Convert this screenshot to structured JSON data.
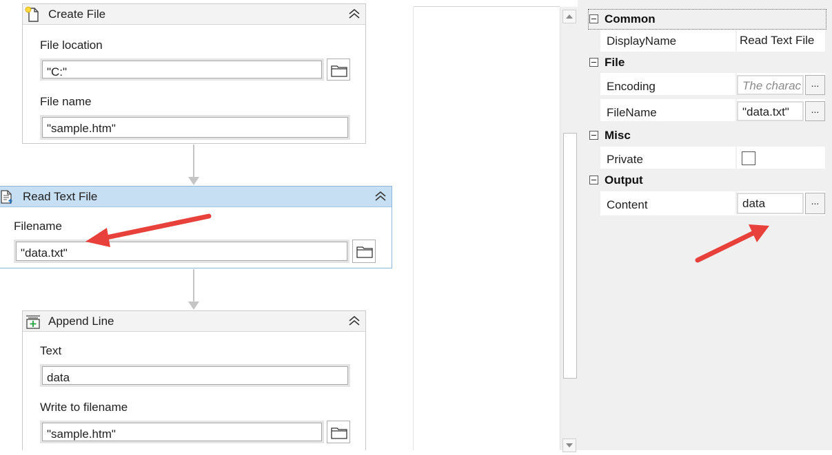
{
  "activities": {
    "create_file": {
      "title": "Create File",
      "location_label": "File location",
      "location_value": "\"C:\"",
      "name_label": "File name",
      "name_value": "\"sample.htm\""
    },
    "read_text_file": {
      "title": "Read Text File",
      "filename_label": "Filename",
      "filename_value": "\"data.txt\""
    },
    "append_line": {
      "title": "Append Line",
      "text_label": "Text",
      "text_value": "data",
      "write_label": "Write to filename",
      "write_value": "\"sample.htm\""
    }
  },
  "properties": {
    "common": {
      "label": "Common",
      "display_name_label": "DisplayName",
      "display_name_value": "Read Text File"
    },
    "file": {
      "label": "File",
      "encoding_label": "Encoding",
      "encoding_placeholder": "The charac",
      "filename_label": "FileName",
      "filename_value": "\"data.txt\""
    },
    "misc": {
      "label": "Misc",
      "private_label": "Private",
      "private_checked": false
    },
    "output": {
      "label": "Output",
      "content_label": "Content",
      "content_value": "data"
    },
    "ellipsis_label": "..."
  },
  "icons": {
    "create_file": "new-file-icon",
    "read_text_file": "read-file-icon",
    "append_line": "append-line-icon",
    "collapse": "double-chevron-up-icon",
    "folder": "folder-icon"
  },
  "colors": {
    "selected_header": "#c7dff2",
    "annotation_arrow": "#e8403a"
  }
}
